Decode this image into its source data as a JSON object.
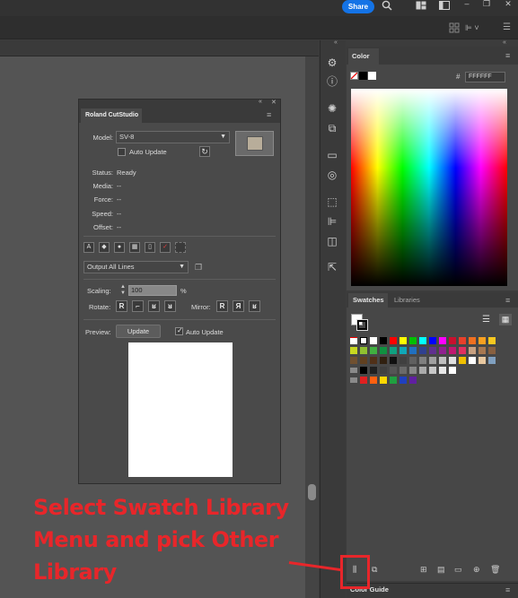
{
  "app": {
    "share_label": "Share"
  },
  "cutstudio": {
    "title": "Roland CutStudio",
    "model_label": "Model:",
    "model_value": "SV-8",
    "auto_update_label": "Auto Update",
    "status_rows": [
      {
        "label": "Status:",
        "value": "Ready"
      },
      {
        "label": "Media:",
        "value": "--"
      },
      {
        "label": "Force:",
        "value": "--"
      },
      {
        "label": "Speed:",
        "value": "--"
      },
      {
        "label": "Offset:",
        "value": "--"
      }
    ],
    "output_option": "Output All Lines",
    "scaling_label": "Scaling:",
    "scaling_value": "100",
    "scaling_unit": "%",
    "rotate_label": "Rotate:",
    "mirror_label": "Mirror:",
    "preview_label": "Preview:",
    "update_button": "Update",
    "preview_auto_update": "Auto Update"
  },
  "color_panel": {
    "tab": "Color",
    "hex_prefix": "#",
    "hex_value": "FFFFFF"
  },
  "swatches_panel": {
    "tabs": [
      "Swatches",
      "Libraries"
    ]
  },
  "color_guide": {
    "tab": "Color Guide"
  },
  "annotation": {
    "line1": "Select Swatch Library",
    "line2": "Menu and pick Other",
    "line3": "Library"
  },
  "colors": {
    "annotation": "#e8262a",
    "share_button": "#1473e6"
  }
}
